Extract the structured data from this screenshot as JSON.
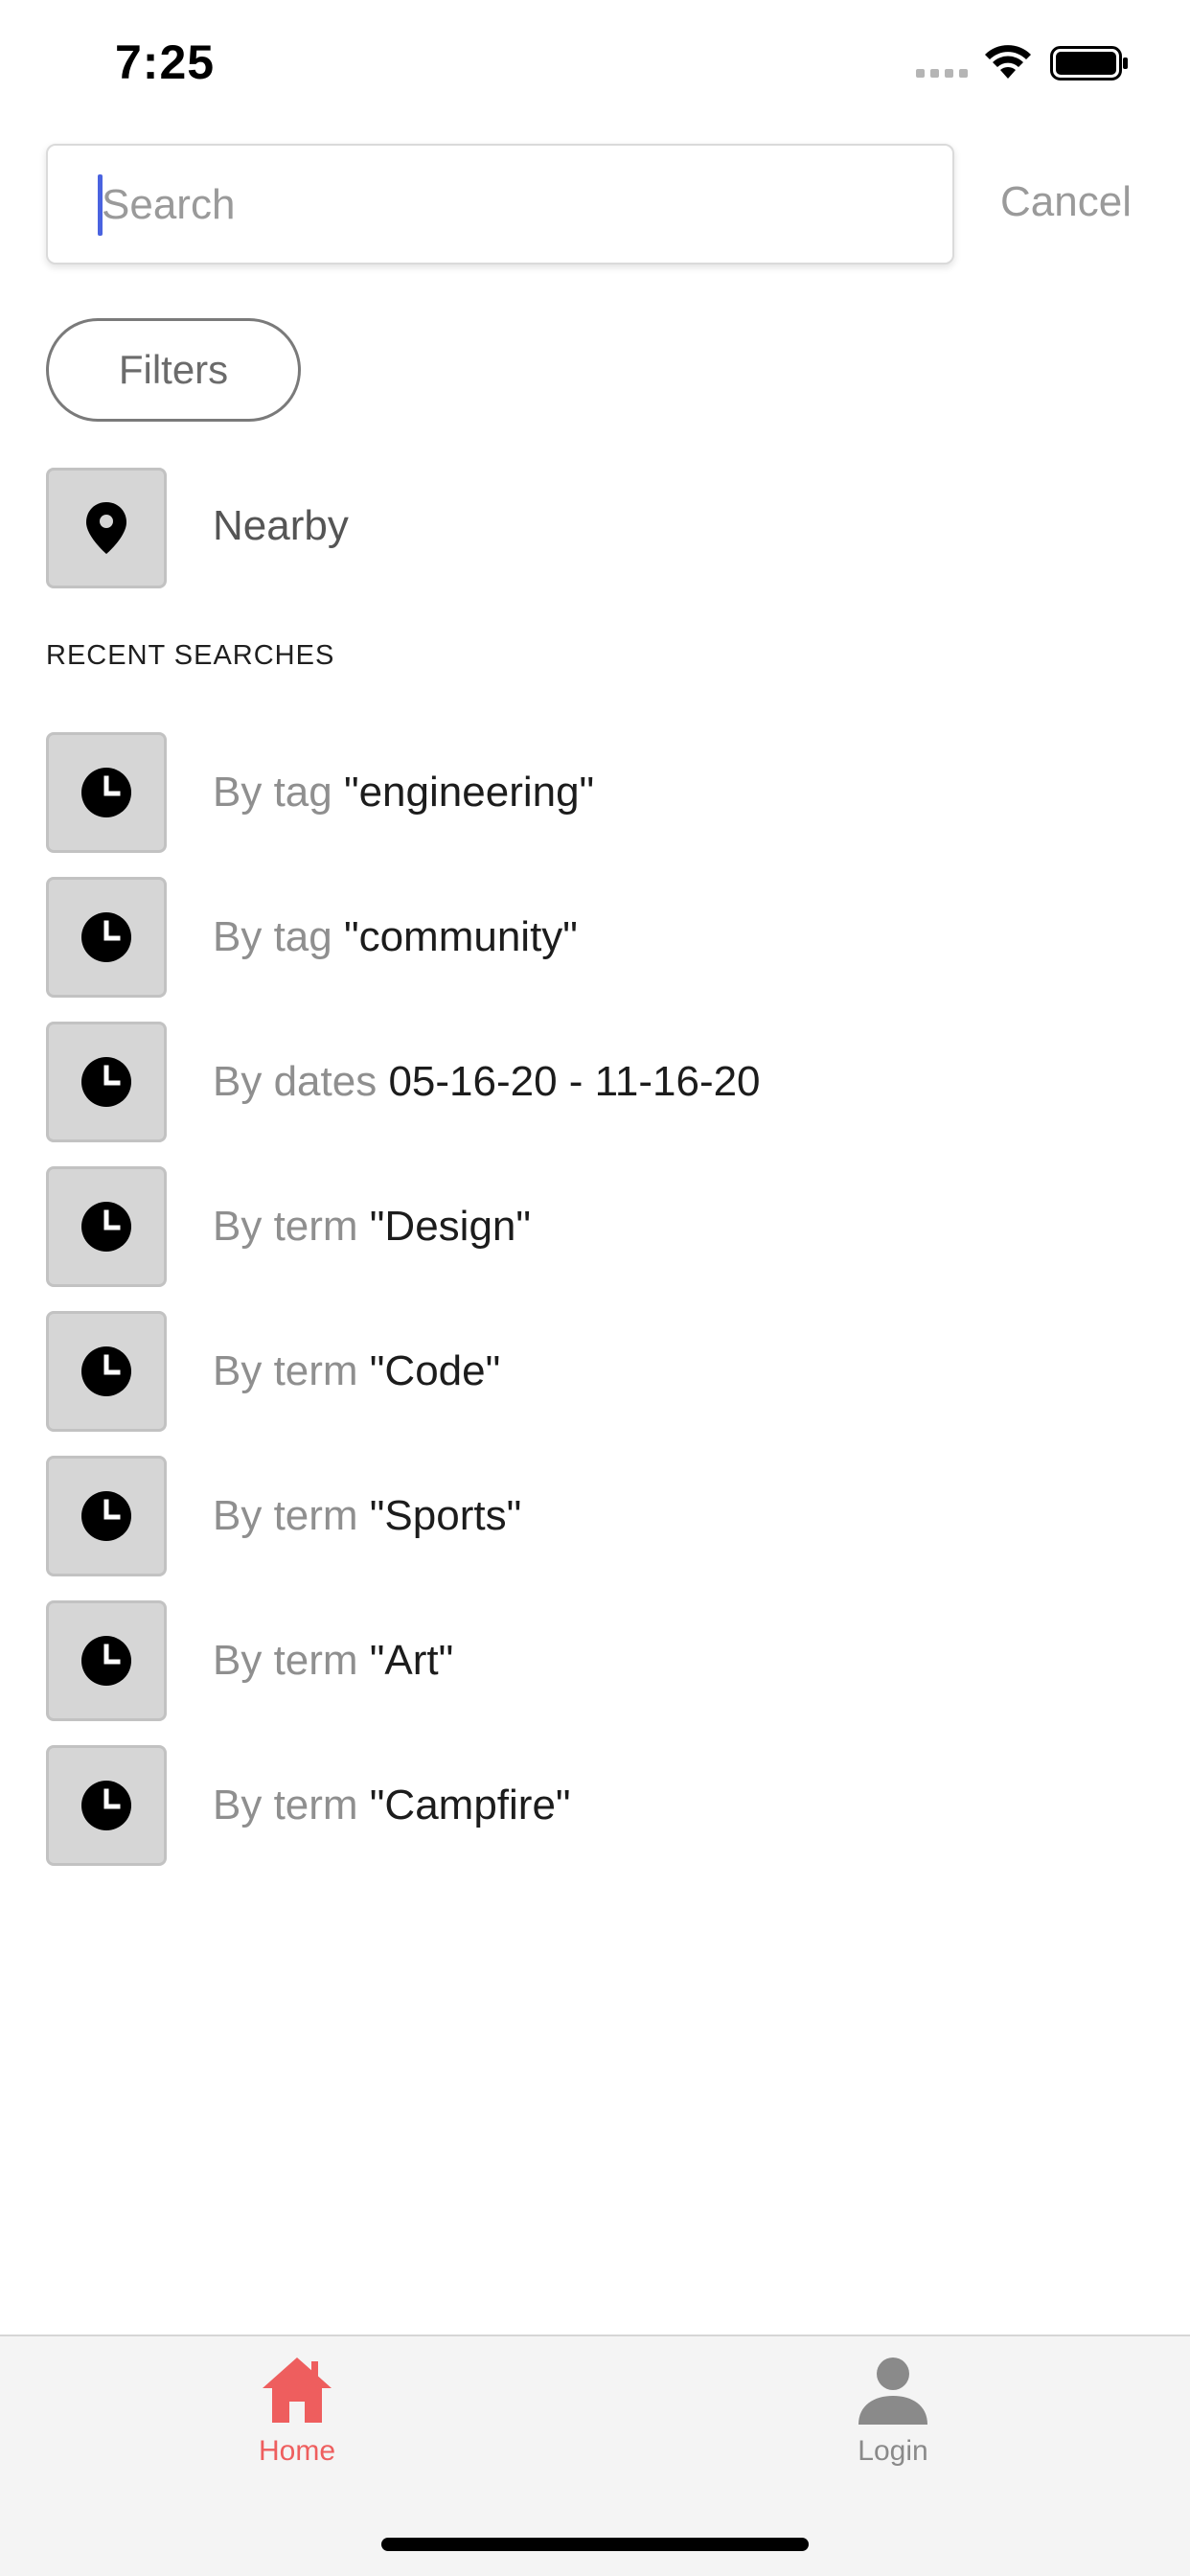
{
  "status_bar": {
    "time": "7:25"
  },
  "search": {
    "placeholder": "Search",
    "value": "",
    "cancel_label": "Cancel"
  },
  "filters": {
    "label": "Filters"
  },
  "nearby": {
    "label": "Nearby",
    "icon": "location-pin-icon"
  },
  "recent": {
    "header": "RECENT SEARCHES",
    "icon": "clock-icon",
    "items": [
      {
        "prefix": "By tag ",
        "value": "\"engineering\""
      },
      {
        "prefix": "By tag ",
        "value": "\"community\""
      },
      {
        "prefix": "By dates ",
        "value": "05-16-20 - 11-16-20"
      },
      {
        "prefix": "By term ",
        "value": "\"Design\""
      },
      {
        "prefix": "By term ",
        "value": "\"Code\""
      },
      {
        "prefix": "By term ",
        "value": "\"Sports\""
      },
      {
        "prefix": "By term ",
        "value": "\"Art\""
      },
      {
        "prefix": "By term ",
        "value": "\"Campfire\""
      }
    ]
  },
  "tab_bar": {
    "active_color": "#ee5e5e",
    "inactive_color": "#8a8a8a",
    "tabs": [
      {
        "label": "Home",
        "icon": "home-icon",
        "active": true
      },
      {
        "label": "Login",
        "icon": "user-icon",
        "active": false
      }
    ]
  }
}
